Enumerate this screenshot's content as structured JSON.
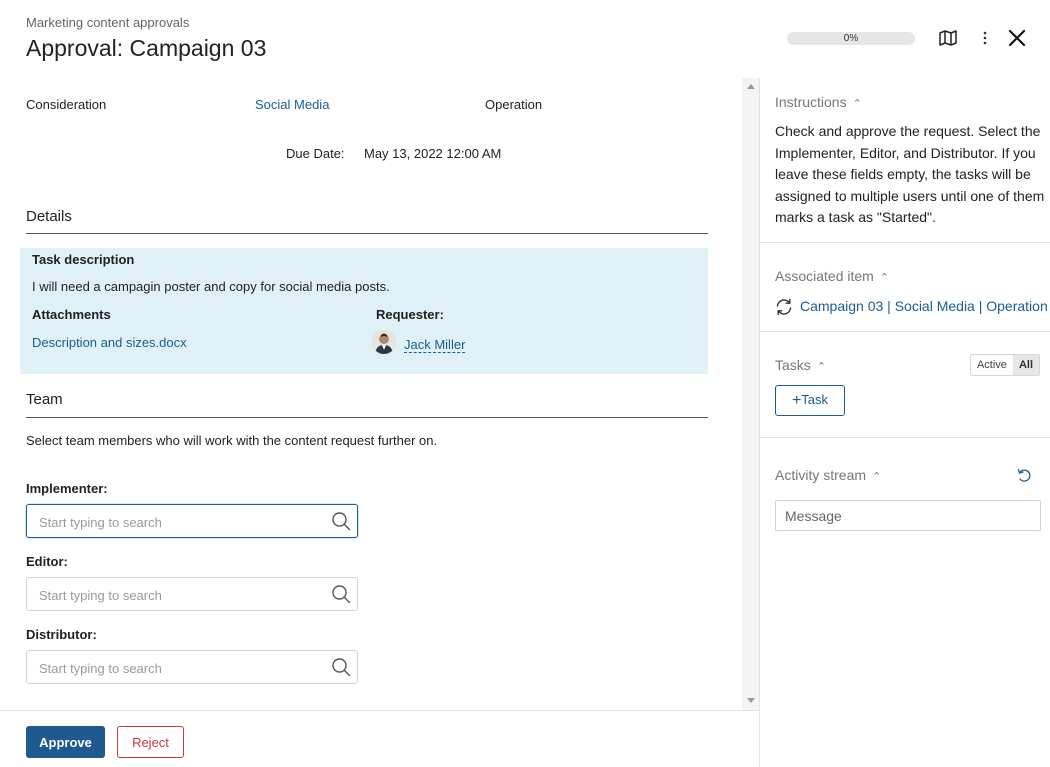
{
  "header": {
    "breadcrumb": "Marketing content approvals",
    "title": "Approval: Campaign 03",
    "progress_label": "0%",
    "progress_value": 0
  },
  "summary": {
    "type_label": "Consideration",
    "channel_link": "Social Media",
    "stage_label": "Operation",
    "due_date_label": "Due Date:",
    "due_date_value": "May 13, 2022 12:00 AM"
  },
  "details": {
    "heading": "Details",
    "task_description_label": "Task description",
    "task_description_text": "I will need a campagin poster and copy for social media posts.",
    "attachments_label": "Attachments",
    "attachment_file": "Description and sizes.docx",
    "requester_label": "Requester:",
    "requester_name": "Jack Miller"
  },
  "team": {
    "heading": "Team",
    "description": "Select team members who will work with the content request further on.",
    "implementer_label": "Implementer:",
    "editor_label": "Editor:",
    "distributor_label": "Distributor:",
    "search_placeholder": "Start typing to search"
  },
  "footer": {
    "approve_label": "Approve",
    "reject_label": "Reject"
  },
  "sidebar": {
    "instructions_title": "Instructions",
    "instructions_text": "Check and approve the request. Select the Implementer, Editor, and Distributor. If you leave these fields empty, the tasks will be assigned to multiple users until one of them marks a task as \"Started\".",
    "associated_title": "Associated item",
    "associated_link": "Campaign 03 | Social Media | Operation",
    "tasks_title": "Tasks",
    "tasks_toggle_active": "Active",
    "tasks_toggle_all": "All",
    "add_task_label": "Task",
    "activity_title": "Activity stream",
    "message_placeholder": "Message"
  },
  "colors": {
    "accent": "#1e5a90",
    "link": "#1a5e95",
    "details_bg": "#dff0f7",
    "reject": "#c73a3a"
  },
  "icons": {
    "map": "map-icon",
    "more": "more-vertical-icon",
    "close": "close-icon",
    "search": "search-icon",
    "sync": "sync-icon",
    "refresh": "refresh-icon",
    "plus": "plus-icon",
    "chevron": "chevron-up-icon"
  }
}
